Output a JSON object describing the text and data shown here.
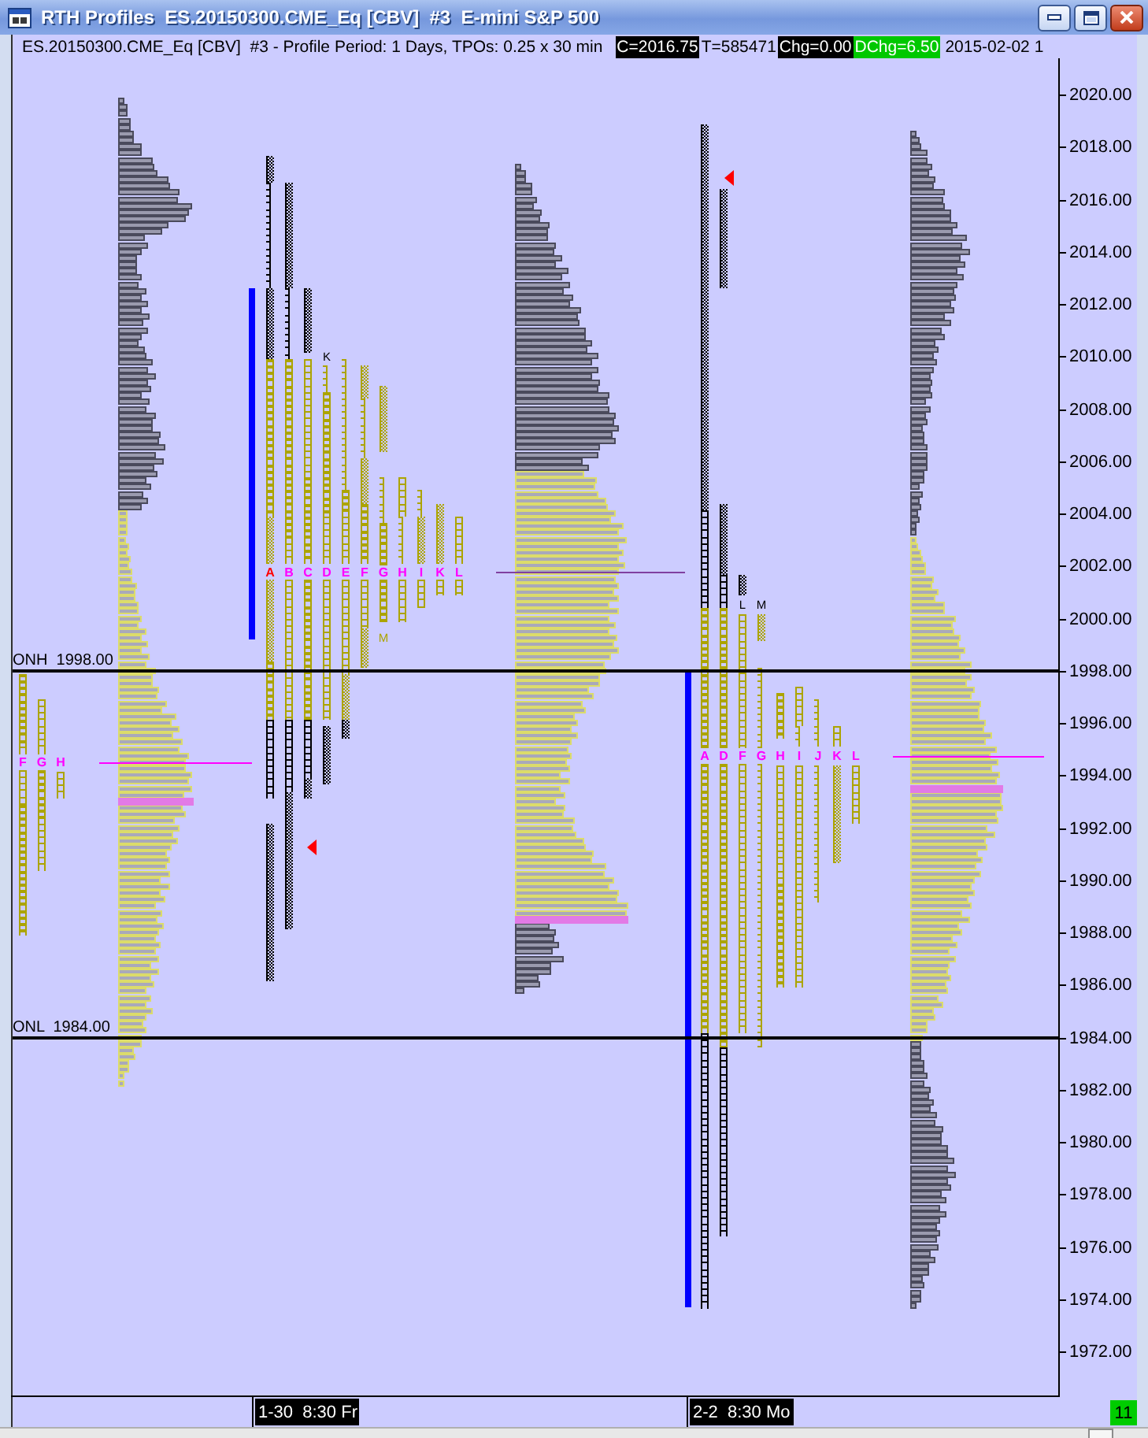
{
  "window": {
    "title": "RTH Profiles  ES.20150300.CME_Eq [CBV]  #3  E-mini S&P 500"
  },
  "header": {
    "description": "ES.20150300.CME_Eq [CBV]  #3 - Profile Period: 1 Days, TPOs: 0.25 x 30 min",
    "readouts": [
      {
        "text": "C=2016.75",
        "kind": "dark"
      },
      {
        "text": "T=585471",
        "kind": "plain"
      },
      {
        "text": "Chg=0.00",
        "kind": "dark"
      },
      {
        "text": "DChg=6.50",
        "kind": "green"
      }
    ],
    "timestamp": "2015-02-02 1"
  },
  "chart": {
    "price_labels": [
      "2020.00",
      "2018.00",
      "2016.00",
      "2014.00",
      "2012.00",
      "2010.00",
      "2008.00",
      "2006.00",
      "2004.00",
      "2002.00",
      "2000.00",
      "1998.00",
      "1996.00",
      "1994.00",
      "1992.00",
      "1990.00",
      "1988.00",
      "1986.00",
      "1984.00",
      "1982.00",
      "1980.00",
      "1978.00",
      "1976.00",
      "1974.00",
      "1972.00"
    ],
    "reference_lines": [
      {
        "label": "ONH  1998.00"
      },
      {
        "label": "ONL  1984.00"
      }
    ],
    "profiles": [
      {
        "kind": "tpo",
        "letters": [
          {
            "text": "F",
            "color": "#ff00ff"
          },
          {
            "text": "G",
            "color": "#ff00ff"
          },
          {
            "text": "H",
            "color": "#ff00ff"
          }
        ]
      },
      {
        "kind": "volume"
      },
      {
        "kind": "tpo",
        "letters": [
          {
            "text": "A",
            "color": "#ff0000"
          },
          {
            "text": "B",
            "color": "#ff00ff"
          },
          {
            "text": "C",
            "color": "#ff00ff"
          },
          {
            "text": "D",
            "color": "#ff00ff"
          },
          {
            "text": "E",
            "color": "#ff00ff"
          },
          {
            "text": "F",
            "color": "#ff00ff"
          },
          {
            "text": "G",
            "color": "#ff00ff"
          },
          {
            "text": "H",
            "color": "#ff00ff"
          },
          {
            "text": "I",
            "color": "#ff00ff"
          },
          {
            "text": "K",
            "color": "#ff00ff"
          },
          {
            "text": "L",
            "color": "#ff00ff"
          }
        ],
        "notes": [
          "K",
          "M"
        ]
      },
      {
        "kind": "volume"
      },
      {
        "kind": "tpo",
        "letters": [
          {
            "text": "A",
            "color": "#ff00ff"
          },
          {
            "text": "D",
            "color": "#ff00ff"
          },
          {
            "text": "F",
            "color": "#ff00ff"
          },
          {
            "text": "G",
            "color": "#ff00ff"
          },
          {
            "text": "H",
            "color": "#ff00ff"
          },
          {
            "text": "I",
            "color": "#ff00ff"
          },
          {
            "text": "J",
            "color": "#ff00ff"
          },
          {
            "text": "K",
            "color": "#ff00ff"
          },
          {
            "text": "L",
            "color": "#ff00ff"
          }
        ],
        "notes": [
          "L",
          "M"
        ]
      },
      {
        "kind": "volume"
      }
    ],
    "time_labels": [
      "1-30  8:30 Fr",
      "2-2  8:30 Mo"
    ],
    "badge": "11"
  }
}
